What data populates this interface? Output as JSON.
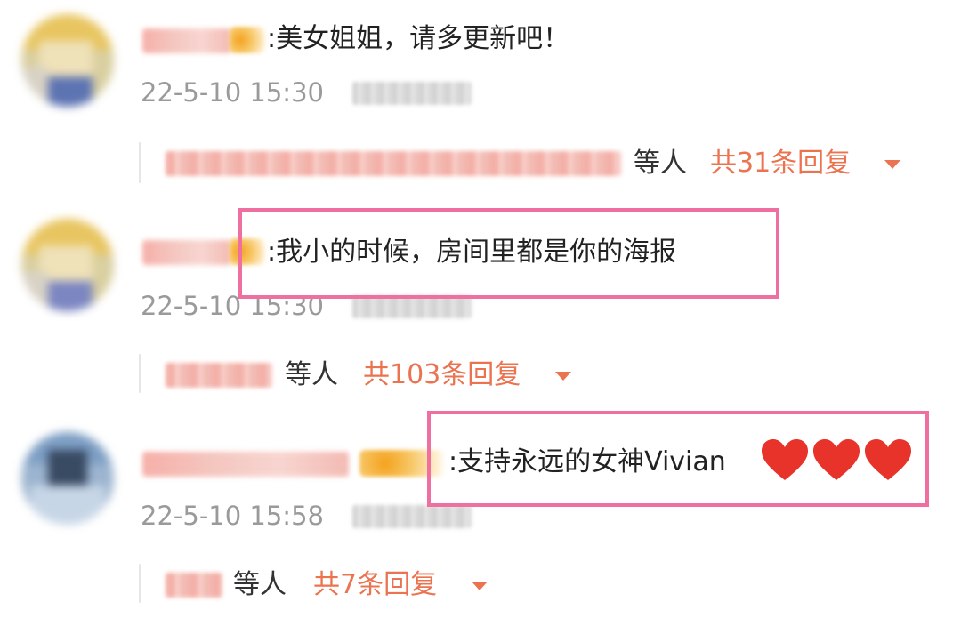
{
  "comments": [
    {
      "text": "美女姐姐，请多更新吧！",
      "time": "22-5-10 15:30",
      "reply_suffix": "等人",
      "reply_total": "共31条回复"
    },
    {
      "text": "我小的时候，房间里都是你的海报",
      "time": "22-5-10 15:30",
      "reply_suffix": "等人",
      "reply_total": "共103条回复"
    },
    {
      "text": "支持永远的女神Vivian",
      "time": "22-5-10 15:58",
      "reply_suffix": "等人",
      "reply_total": "共7条回复"
    }
  ],
  "colors": {
    "accent": "#eb7350",
    "highlight": "#ef6fa0",
    "timestamp": "#9a9a9a",
    "heart": "#e8332a"
  },
  "icons": [
    "heart-emoji",
    "caret-down-icon"
  ]
}
